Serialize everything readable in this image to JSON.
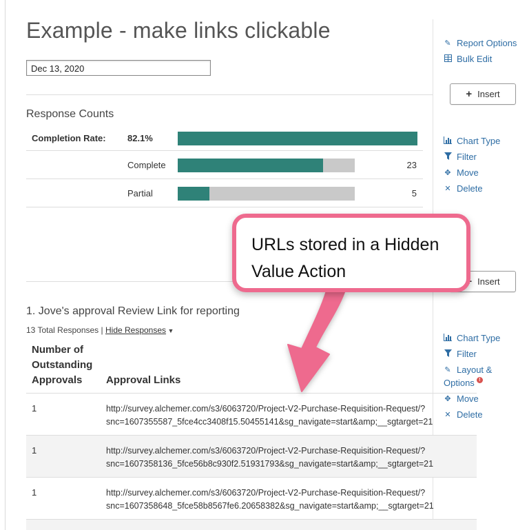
{
  "page": {
    "title": "Example - make links clickable",
    "date_value": "Dec 13, 2020"
  },
  "sidebar_top": {
    "report_options": "Report Options",
    "bulk_edit": "Bulk Edit"
  },
  "insert_label": "Insert",
  "response_counts": {
    "title": "Response Counts",
    "completion_label": "Completion Rate:",
    "completion_value": "82.1%",
    "completion_fraction": 0.821,
    "rows": [
      {
        "label": "Complete",
        "count": "23",
        "fraction": 0.82
      },
      {
        "label": "Partial",
        "count": "5",
        "fraction": 0.18
      }
    ]
  },
  "element_tools_1": {
    "chart_type": "Chart Type",
    "filter": "Filter",
    "move": "Move",
    "delete": "Delete"
  },
  "callout": {
    "text": "URLs stored in a Hidden Value Action"
  },
  "question": {
    "title": "1. Jove's approval Review Link for reporting",
    "total_responses": "13 Total Responses |",
    "hide_responses": "Hide Responses",
    "col_headers": [
      "Number of Outstanding Approvals",
      "Approval Links"
    ],
    "rows": [
      {
        "number": "1",
        "url_line1": "http://survey.alchemer.com/s3/6063720/Project-V2-Purchase-Requisition-Request/?",
        "url_line2": "snc=1607355587_5fce4cc3408f15.50455141&sg_navigate=start&amp;__sgtarget=21"
      },
      {
        "number": "1",
        "url_line1": "http://survey.alchemer.com/s3/6063720/Project-V2-Purchase-Requisition-Request/?",
        "url_line2": "snc=1607358136_5fce56b8c930f2.51931793&sg_navigate=start&amp;__sgtarget=21"
      },
      {
        "number": "1",
        "url_line1": "http://survey.alchemer.com/s3/6063720/Project-V2-Purchase-Requisition-Request/?",
        "url_line2": "snc=1607358648_5fce58b8567fe6.20658382&sg_navigate=start&amp;__sgtarget=21"
      }
    ]
  },
  "element_tools_2": {
    "chart_type": "Chart Type",
    "filter": "Filter",
    "layout_options_1": "Layout &",
    "layout_options_2": "Options",
    "alert_icon": "!",
    "move": "Move",
    "delete": "Delete"
  },
  "colors": {
    "bar_fill": "#2f8278",
    "bar_bg": "#c9c9c9",
    "link": "#2e6da4",
    "callout_border": "#ee6a8e",
    "alert": "#d9534f"
  }
}
